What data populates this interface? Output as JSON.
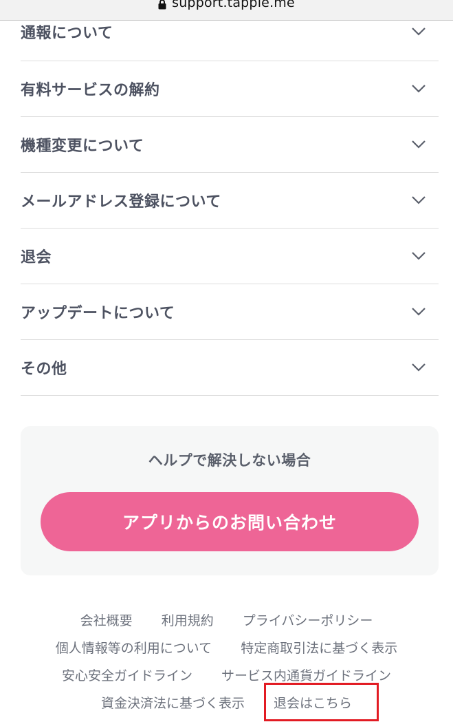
{
  "browser": {
    "url": "support.tapple.me",
    "icons": {
      "lock": "lock-icon"
    }
  },
  "faq": {
    "chevron_icon": "chevron-down-icon",
    "items": [
      {
        "label": "通報について"
      },
      {
        "label": "有料サービスの解約"
      },
      {
        "label": "機種変更について"
      },
      {
        "label": "メールアドレス登録について"
      },
      {
        "label": "退会"
      },
      {
        "label": "アップデートについて"
      },
      {
        "label": "その他"
      }
    ]
  },
  "help_box": {
    "title": "ヘルプで解決しない場合",
    "contact_button": "アプリからのお問い合わせ"
  },
  "footer": {
    "links": [
      "会社概要",
      "利用規約",
      "プライバシーポリシー",
      "個人情報等の利用について",
      "特定商取引法に基づく表示",
      "安心安全ガイドライン",
      "サービス内通貨ガイドライン",
      "資金決済法に基づく表示",
      "退会はこちら"
    ]
  },
  "colors": {
    "accent": "#ee6596",
    "highlight_border": "#e21b23",
    "text": "#4d5261",
    "footer_link": "#6c717c",
    "divider": "#dcdcdc",
    "help_box_bg": "#f6f7f7"
  }
}
